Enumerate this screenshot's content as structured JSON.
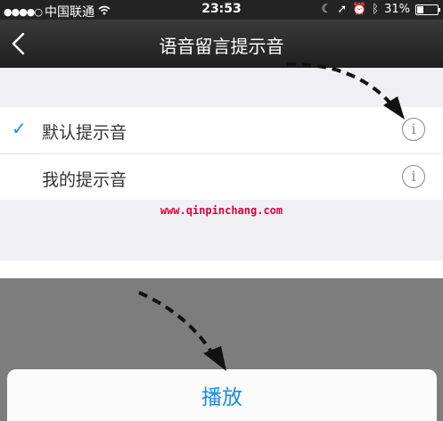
{
  "status_bar": {
    "signal_dots": "●●●●○",
    "carrier": "中国联通",
    "time": "23:53",
    "battery_percent": "31%",
    "battery_level": 0.31
  },
  "nav": {
    "title": "语音留言提示音"
  },
  "list": {
    "items": [
      {
        "label": "默认提示音",
        "selected": true
      },
      {
        "label": "我的提示音",
        "selected": false
      }
    ]
  },
  "watermark": "www.qinpinchang.com",
  "action": {
    "play_label": "播放"
  },
  "colors": {
    "accent": "#1a8ae8",
    "watermark": "#e0003c",
    "overlay": "#7d7d7d"
  }
}
